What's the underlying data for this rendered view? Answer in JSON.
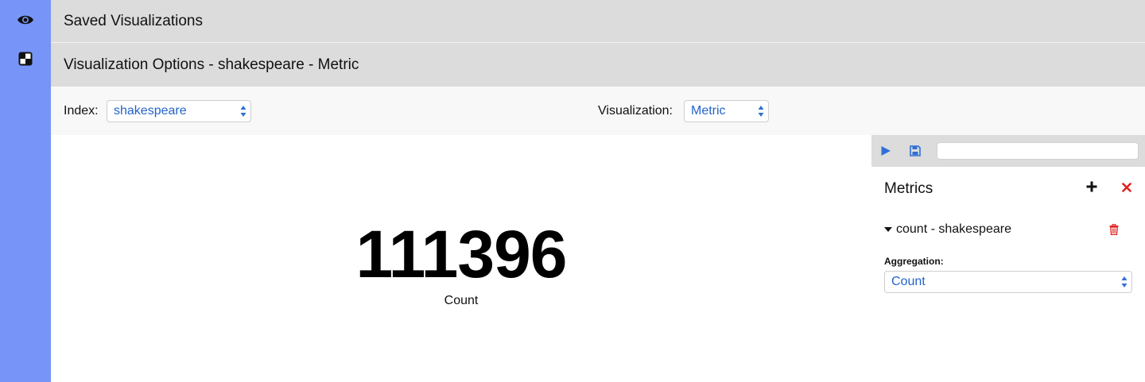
{
  "header": {
    "saved_title": "Saved Visualizations",
    "options_title": "Visualization Options - shakespeare - Metric"
  },
  "rail": {
    "items": [
      {
        "icon": "eye-icon"
      },
      {
        "icon": "dashboard-icon"
      }
    ]
  },
  "options": {
    "index_label": "Index:",
    "index_value": "shakespeare",
    "visualization_label": "Visualization:",
    "visualization_value": "Metric"
  },
  "metric": {
    "value": "111396",
    "label": "Count"
  },
  "panel": {
    "toolbar": {
      "play_icon": "play-icon",
      "save_icon": "save-icon",
      "search_value": ""
    },
    "metrics_title": "Metrics",
    "metric_item": "count - shakespeare",
    "aggregation_label": "Aggregation:",
    "aggregation_value": "Count"
  },
  "colors": {
    "rail": "#7795f8",
    "header_bar": "#dcdcdc",
    "select_text": "#2463c9",
    "accent_blue": "#2f6fd6",
    "delete_red": "#e02020"
  }
}
